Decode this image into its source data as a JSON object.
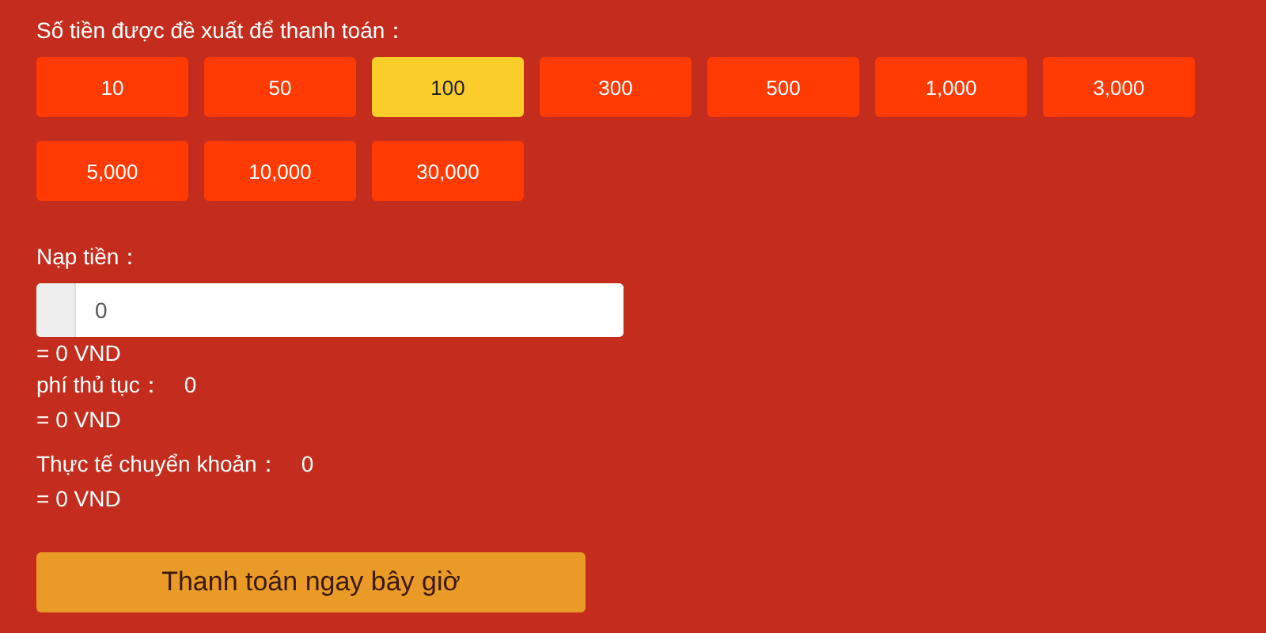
{
  "amounts_title": "Số tiền được đề xuất để thanh toán：",
  "amounts": [
    {
      "label": "10",
      "selected": false
    },
    {
      "label": "50",
      "selected": false
    },
    {
      "label": "100",
      "selected": true
    },
    {
      "label": "300",
      "selected": false
    },
    {
      "label": "500",
      "selected": false
    },
    {
      "label": "1,000",
      "selected": false
    },
    {
      "label": "3,000",
      "selected": false
    },
    {
      "label": "5,000",
      "selected": false
    },
    {
      "label": "10,000",
      "selected": false
    },
    {
      "label": "30,000",
      "selected": false
    }
  ],
  "deposit": {
    "label": "Nạp tiền：",
    "value": "0",
    "converted": "= 0 VND"
  },
  "fee": {
    "label": "phí thủ tục：",
    "value": "0",
    "converted": "= 0 VND"
  },
  "actual": {
    "label": "Thực tế chuyển khoản：",
    "value": "0",
    "converted": "= 0 VND"
  },
  "submit_button": "Thanh toán ngay bây giờ"
}
